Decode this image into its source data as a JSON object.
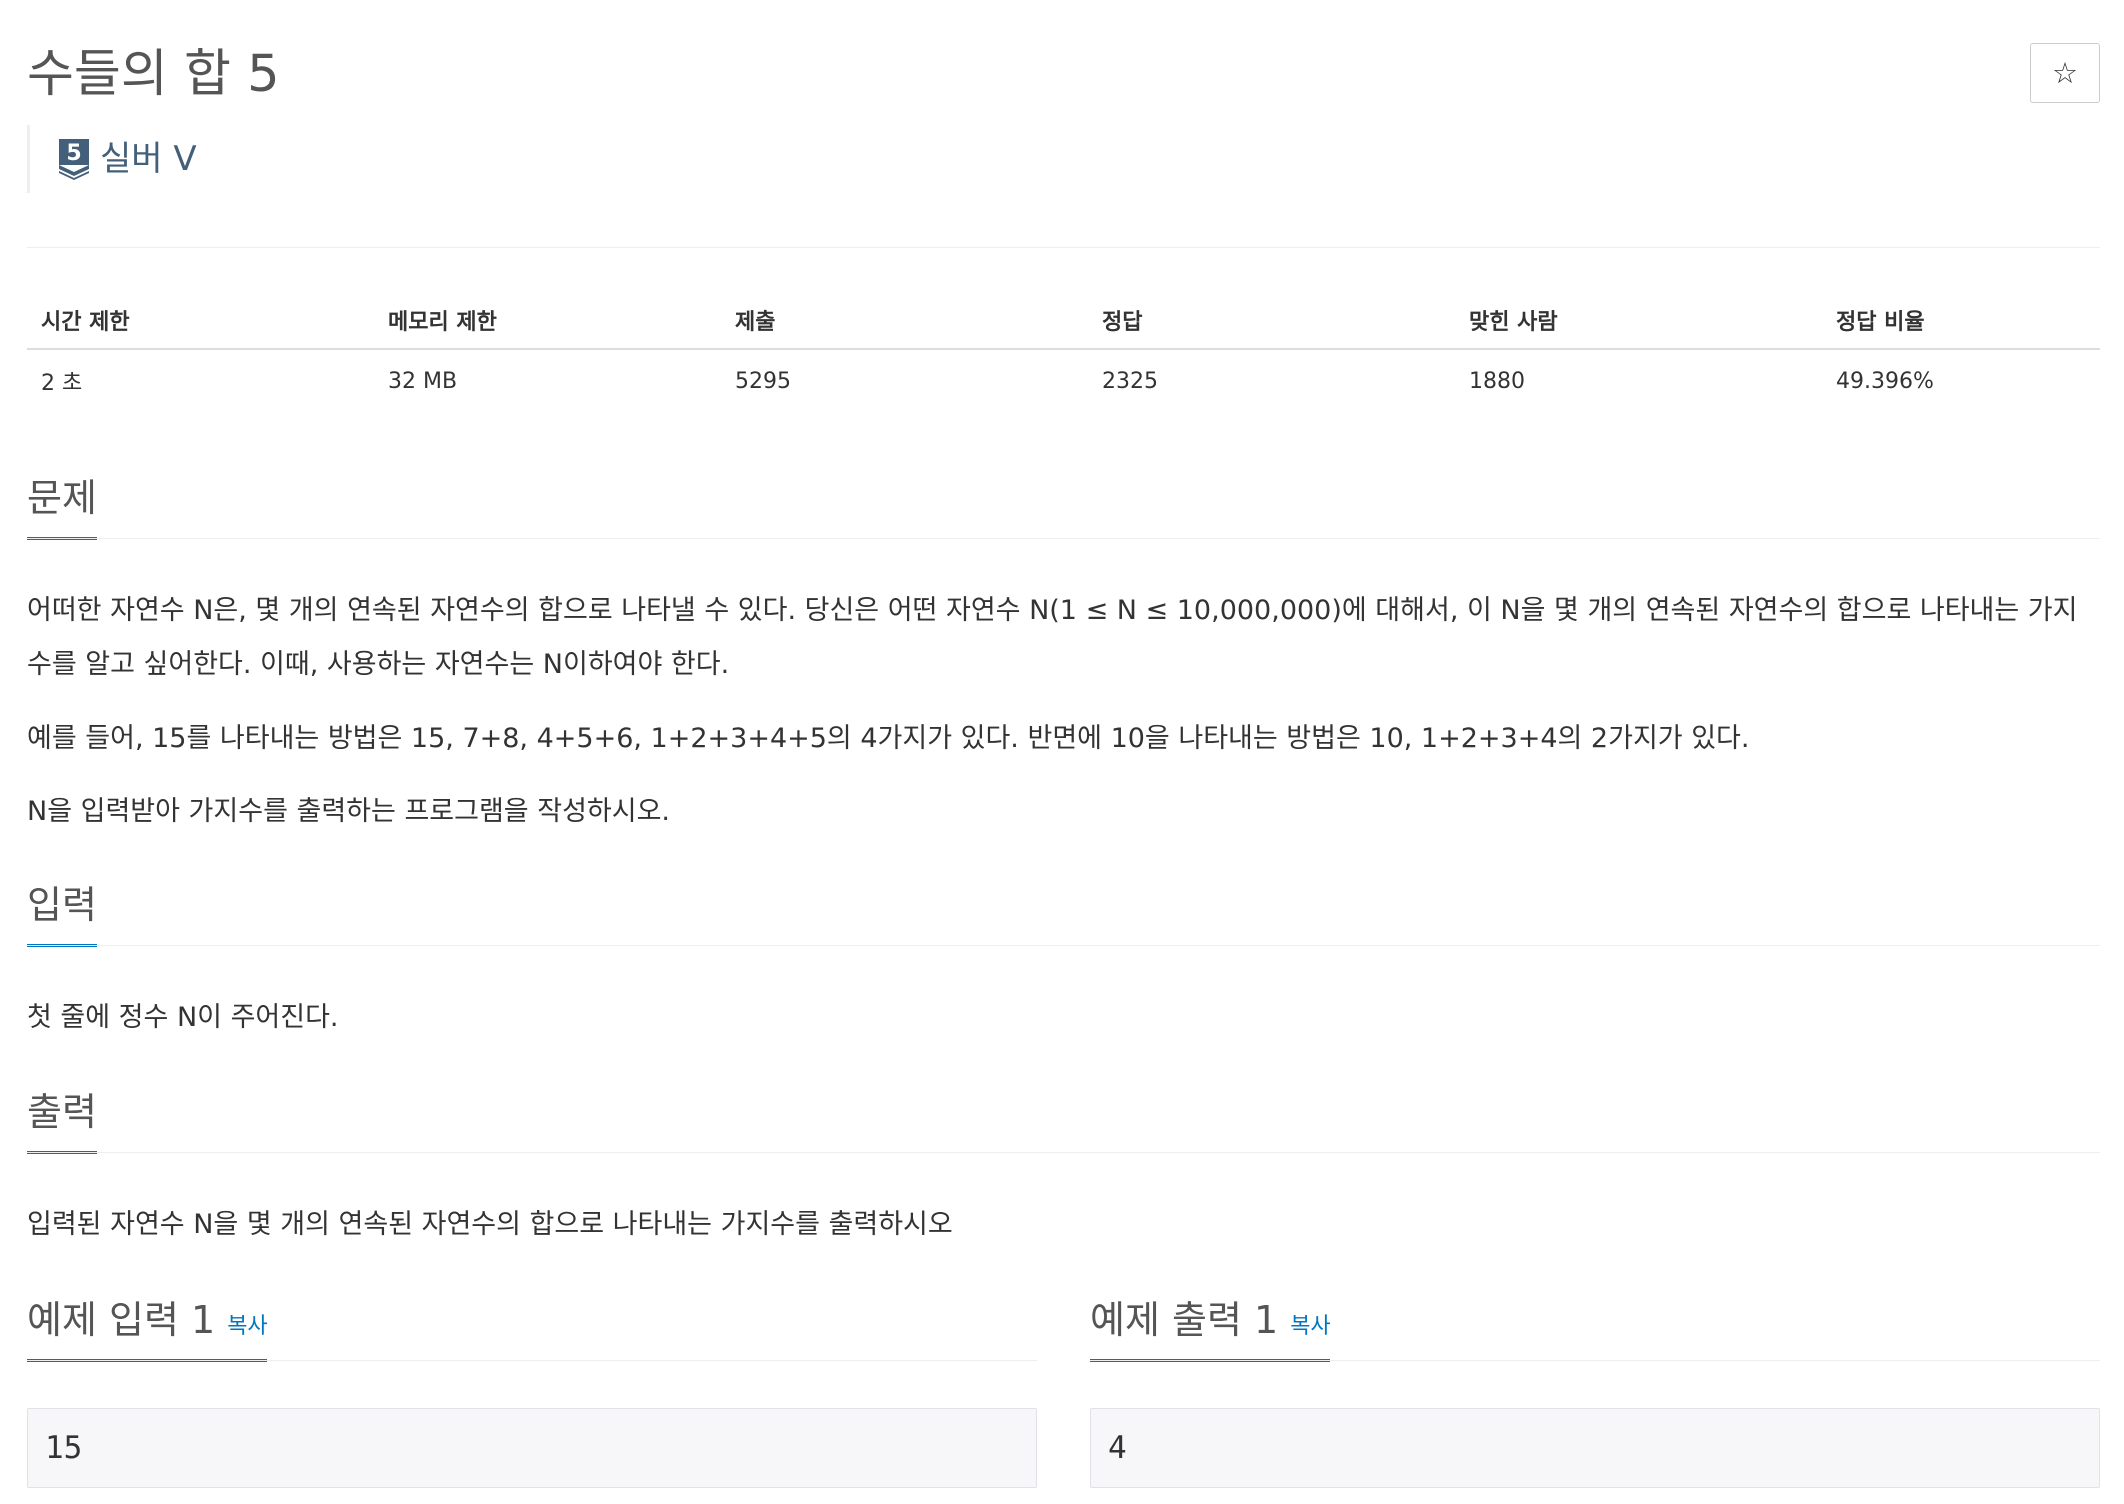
{
  "problem": {
    "title": "수들의 합 5",
    "star_icon": "☆",
    "tier": {
      "badge_number": "5",
      "label": "실버 V",
      "color": "#435f7a"
    }
  },
  "stats": {
    "headers": [
      "시간 제한",
      "메모리 제한",
      "제출",
      "정답",
      "맞힌 사람",
      "정답 비율"
    ],
    "values": [
      "2 초",
      "32 MB",
      "5295",
      "2325",
      "1880",
      "49.396%"
    ]
  },
  "sections": {
    "description": {
      "heading": "문제",
      "paragraphs": [
        "어떠한 자연수 N은, 몇 개의 연속된 자연수의 합으로 나타낼 수 있다. 당신은 어떤 자연수 N(1 ≤ N ≤ 10,000,000)에 대해서, 이 N을 몇 개의 연속된 자연수의 합으로 나타내는 가지수를 알고 싶어한다. 이때, 사용하는 자연수는 N이하여야 한다.",
        "예를 들어, 15를 나타내는 방법은 15, 7+8, 4+5+6, 1+2+3+4+5의 4가지가 있다. 반면에 10을 나타내는 방법은 10, 1+2+3+4의 2가지가 있다.",
        "N을 입력받아 가지수를 출력하는 프로그램을 작성하시오."
      ]
    },
    "input": {
      "heading": "입력",
      "paragraph": "첫 줄에 정수 N이 주어진다."
    },
    "output": {
      "heading": "출력",
      "paragraph": "입력된 자연수 N을 몇 개의 연속된 자연수의 합으로 나타내는 가지수를 출력하시오"
    }
  },
  "samples": {
    "input": {
      "heading": "예제 입력 1",
      "copy_label": "복사",
      "value": "15"
    },
    "output": {
      "heading": "예제 출력 1",
      "copy_label": "복사",
      "value": "4"
    }
  },
  "colors": {
    "accent": "#0076c0",
    "heading_text": "#555555",
    "body_text": "#333333"
  }
}
